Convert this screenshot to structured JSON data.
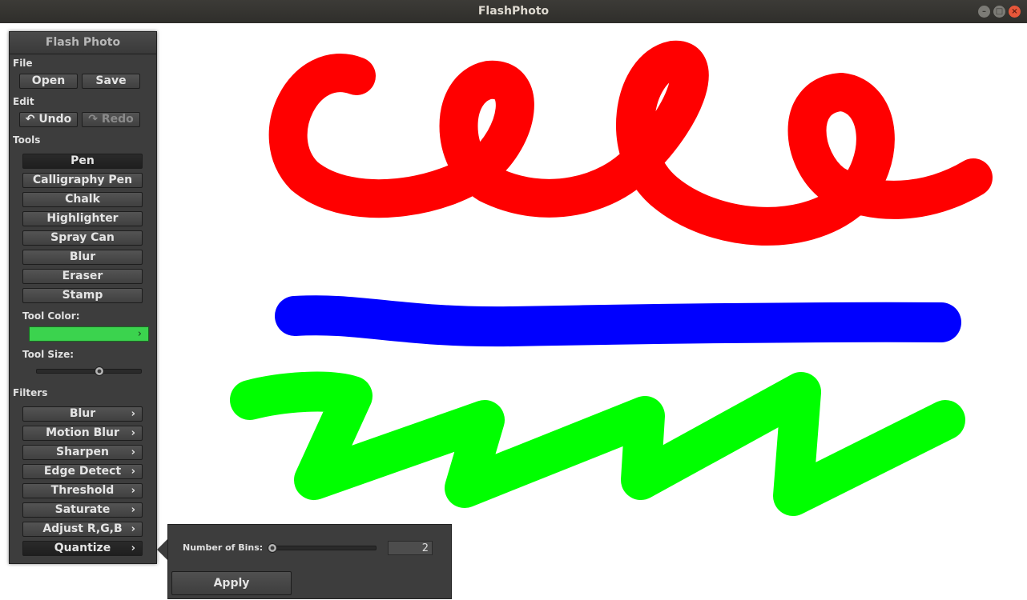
{
  "window": {
    "title": "FlashPhoto"
  },
  "panel": {
    "title": "Flash Photo",
    "file": {
      "label": "File",
      "open": "Open",
      "save": "Save"
    },
    "edit": {
      "label": "Edit",
      "undo": "Undo",
      "redo": "Redo"
    },
    "tools": {
      "label": "Tools",
      "items": [
        "Pen",
        "Calligraphy Pen",
        "Chalk",
        "Highlighter",
        "Spray Can",
        "Blur",
        "Eraser",
        "Stamp"
      ],
      "selected": "Pen",
      "color_label": "Tool Color:",
      "color_value": "#3bd34e",
      "size_label": "Tool Size:",
      "size_fraction": 0.61
    },
    "filters": {
      "label": "Filters",
      "items": [
        "Blur",
        "Motion Blur",
        "Sharpen",
        "Edge Detect",
        "Threshold",
        "Saturate",
        "Adjust R,G,B",
        "Quantize"
      ],
      "selected": "Quantize"
    }
  },
  "popup": {
    "bins_label": "Number of Bins:",
    "bins_value": "2",
    "slider_fraction": 0.0,
    "apply_label": "Apply"
  },
  "strokes": {
    "red": "#ff0000",
    "blue": "#0000ff",
    "green": "#00ff00"
  }
}
